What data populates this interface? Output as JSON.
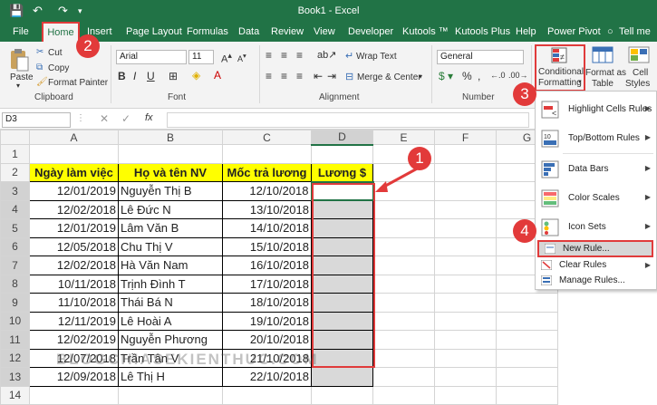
{
  "title": "Book1 - Excel",
  "qat": {
    "save": "💾",
    "undo": "↶",
    "redo": "↷"
  },
  "menu": [
    "File",
    "Home",
    "Insert",
    "Page Layout",
    "Formulas",
    "Data",
    "Review",
    "View",
    "Developer",
    "Kutools ™",
    "Kutools Plus",
    "Help",
    "Power Pivot",
    "Tell me"
  ],
  "ribbon": {
    "paste": "Paste",
    "cut": "Cut",
    "copy": "Copy",
    "format_painter": "Format Painter",
    "clipboard": "Clipboard",
    "font_name": "Arial",
    "font_size": "11",
    "font_group": "Font",
    "wrap_text": "Wrap Text",
    "merge_center": "Merge & Center",
    "alignment": "Alignment",
    "number_format": "General",
    "number": "Number",
    "cf_line1": "Conditional",
    "cf_line2": "Formatting",
    "fat_line1": "Format as",
    "fat_line2": "Table",
    "cs_line1": "Cell",
    "cs_line2": "Styles"
  },
  "formula_bar": {
    "name_box": "D3",
    "fx": "fx",
    "value": ""
  },
  "columns": [
    "A",
    "B",
    "C",
    "D",
    "E",
    "F",
    "G"
  ],
  "rows": [
    "1",
    "2",
    "3",
    "4",
    "5",
    "6",
    "7",
    "8",
    "9",
    "10",
    "11",
    "12",
    "13",
    "14"
  ],
  "headers": [
    "Ngày làm việc",
    "Họ và tên NV",
    "Mốc trả lương",
    "Lương $"
  ],
  "data": [
    [
      "12/01/2019",
      "Nguyễn Thị B",
      "12/10/2018"
    ],
    [
      "12/02/2018",
      "Lê Đức N",
      "13/10/2018"
    ],
    [
      "12/01/2019",
      "Lâm Văn B",
      "14/10/2018"
    ],
    [
      "12/05/2018",
      "Chu Thị V",
      "15/10/2018"
    ],
    [
      "12/02/2018",
      "Hà Văn Nam",
      "16/10/2018"
    ],
    [
      "10/11/2018",
      "Trịnh Đình T",
      "17/10/2018"
    ],
    [
      "11/10/2018",
      "Thái Bá N",
      "18/10/2018"
    ],
    [
      "12/11/2019",
      "Lê Hoài A",
      "19/10/2018"
    ],
    [
      "12/02/2019",
      "Nguyễn Phương",
      "20/10/2018"
    ],
    [
      "12/07/2018",
      "Trần Tân V",
      "21/10/2018"
    ],
    [
      "12/09/2018",
      "Lê Thị H",
      "22/10/2018"
    ]
  ],
  "dropdown": [
    "Highlight Cells Rules",
    "Top/Bottom Rules",
    "Data Bars",
    "Color Scales",
    "Icon Sets",
    "New Rule...",
    "Clear Rules",
    "Manage Rules..."
  ],
  "badges": [
    "1",
    "2",
    "3",
    "4"
  ],
  "watermark": "BLOGCHIASEKIENTHUC.COM",
  "colors": {
    "excel_green": "#217346",
    "highlight_red": "#e03b3b",
    "header_yellow": "#ffff00",
    "selection_gray": "#d9d9d9"
  }
}
